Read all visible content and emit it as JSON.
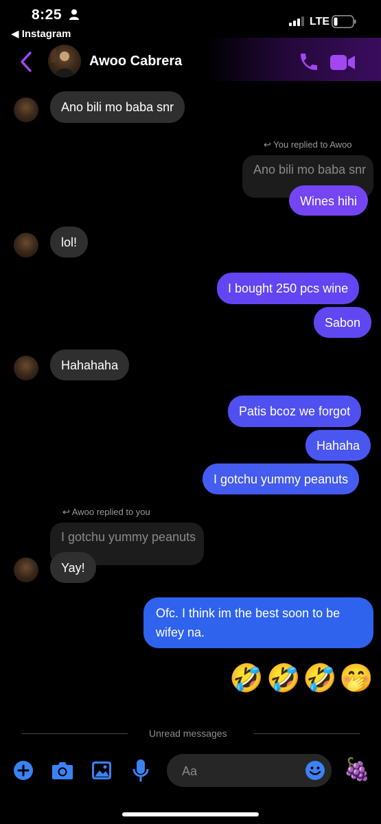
{
  "status_bar": {
    "time": "8:25",
    "back_app": "◀ Instagram",
    "network": "LTE"
  },
  "header": {
    "contact_name": "Awoo Cabrera",
    "accent_color": "#a347f2"
  },
  "messages": {
    "m1": "Ano bili mo baba snr",
    "reply_hint_1": "You replied to Awoo",
    "quote_1": "Ano bili mo baba snr",
    "m2": "Wines hihi",
    "m3": "lol!",
    "m4": "I bought 250 pcs wine",
    "m5": "Sabon",
    "m6": "Hahahaha",
    "m7": "Patis bcoz we forgot",
    "m8": "Hahaha",
    "m9": "I gotchu yummy peanuts",
    "reply_hint_2": "Awoo replied to you",
    "quote_2": "I gotchu yummy peanuts",
    "m10": "Yay!",
    "m11_line1": "Ofc. I think im the best soon to be",
    "m11_line2": "wifey na.",
    "emojis": [
      "🤣",
      "🤣",
      "🤣",
      "🤭"
    ]
  },
  "divider": {
    "label": "Unread messages"
  },
  "composer": {
    "placeholder": "Aa",
    "sticker": "🍇"
  },
  "colors": {
    "incoming": "#2f2f2f",
    "outgoing_purple": "#6f45f3",
    "outgoing_blue": "#2f63ee",
    "accent": "#a347f2",
    "icon_blue": "#3b82f6"
  }
}
